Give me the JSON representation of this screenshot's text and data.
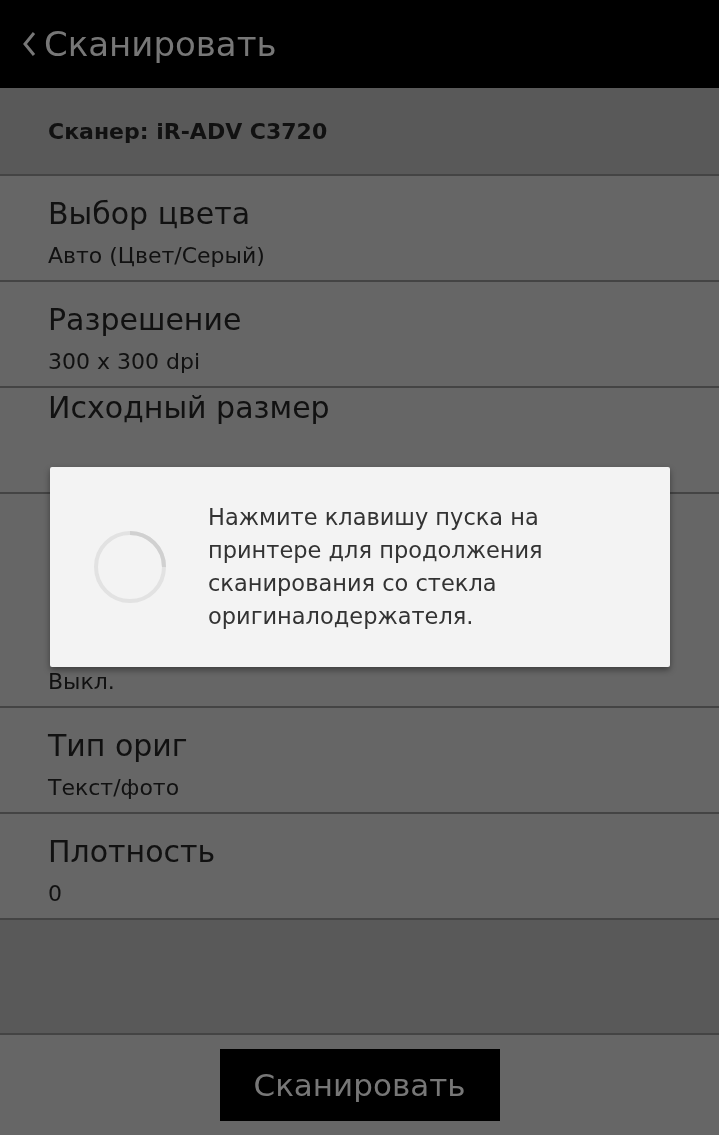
{
  "header": {
    "title": "Сканировать"
  },
  "scanner": {
    "label": "Сканер: iR-ADV C3720"
  },
  "settings": [
    {
      "title": "Выбор цвета",
      "value": "Авто (Цвет/Серый)"
    },
    {
      "title": "Разрешение",
      "value": "300 x 300 dpi"
    },
    {
      "title": "Исходный размер"
    },
    {
      "value": "Выкл."
    },
    {
      "title": "Тип ориг",
      "value": "Текст/фото"
    },
    {
      "title": "Плотность",
      "value": "0"
    }
  ],
  "scan_button": {
    "label": "Сканировать"
  },
  "dialog": {
    "message": "Нажмите клавишу пуска на принтере для продолжения сканирования со стекла оригиналодержателя."
  }
}
